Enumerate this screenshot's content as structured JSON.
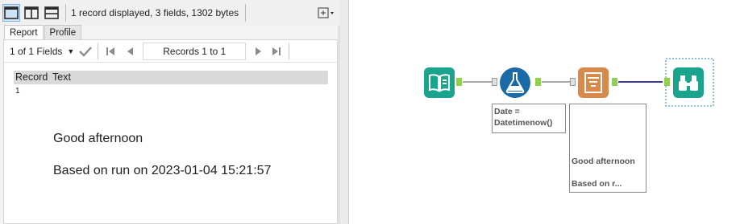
{
  "toolbar": {
    "status": "1 record displayed, 3 fields, 1302 bytes",
    "icons": [
      "single-pane-icon",
      "split-pane-icon",
      "stacked-pane-icon",
      "options-menu-icon"
    ]
  },
  "tabs": [
    {
      "label": "Report",
      "active": true
    },
    {
      "label": "Profile",
      "active": false
    }
  ],
  "navbar": {
    "fields_selector": "1 of 1 Fields",
    "records_label": "Records 1 to 1"
  },
  "grid": {
    "columns": [
      "Record",
      "Text"
    ],
    "rows": [
      {
        "record": "1",
        "lines": [
          "Good afternoon",
          "Based on run on 2023-01-04 15:21:57"
        ]
      }
    ]
  },
  "workflow": {
    "tools": [
      {
        "name": "input-data",
        "color": "#1aa48e",
        "icon": "book-icon"
      },
      {
        "name": "formula",
        "color": "#1a6aa8",
        "icon": "flask-icon"
      },
      {
        "name": "report-text",
        "color": "#d9894a",
        "icon": "document-icon"
      },
      {
        "name": "browse",
        "color": "#1aa48e",
        "icon": "binoculars-icon"
      }
    ],
    "annotations": {
      "formula": "Date =\nDatetimenow()",
      "report_text_line1": "Good afternoon",
      "report_text_line2": "Based on r..."
    },
    "colors": {
      "connector": "#3a3a9e",
      "connector_light": "#8c8c8c",
      "anchor": "#8fd14f",
      "selection": "#2a7fc0"
    }
  }
}
